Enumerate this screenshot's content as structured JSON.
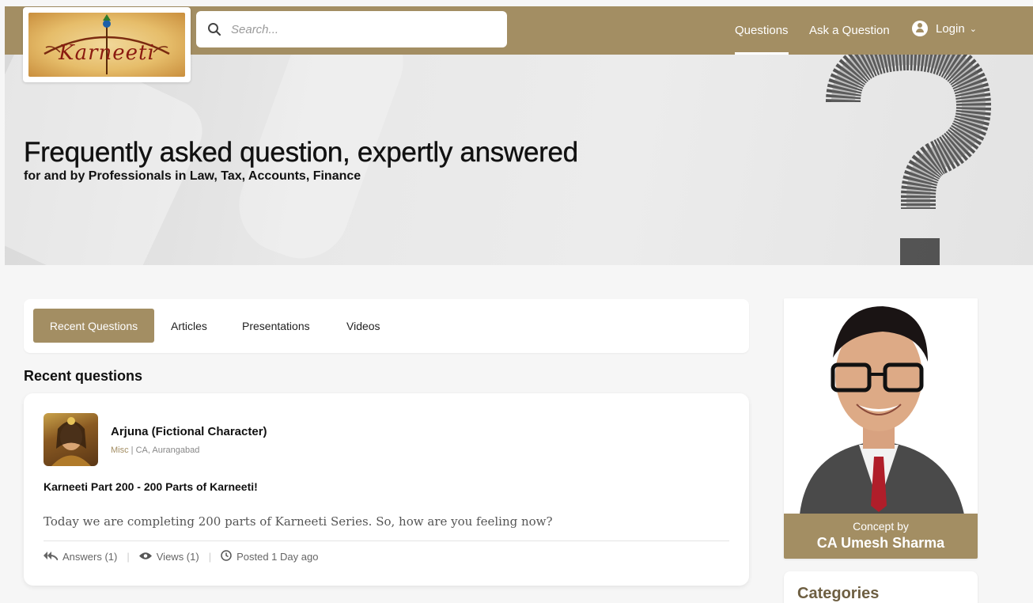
{
  "brand": {
    "logo_text": "Karneeti",
    "accent_color": "#a38e63"
  },
  "search": {
    "placeholder": "Search..."
  },
  "nav": {
    "questions": "Questions",
    "ask": "Ask a Question",
    "login": "Login"
  },
  "hero": {
    "title": "Frequently asked question, expertly answered",
    "subtitle": "for and by Professionals in Law, Tax, Accounts, Finance"
  },
  "tabs": [
    {
      "label": "Recent Questions",
      "active": true
    },
    {
      "label": "Articles",
      "active": false
    },
    {
      "label": "Presentations",
      "active": false
    },
    {
      "label": "Videos",
      "active": false
    }
  ],
  "section_title": "Recent questions",
  "question": {
    "author": "Arjuna (Fictional Character)",
    "category": "Misc",
    "author_detail": " | CA, Aurangabad",
    "title": "Karneeti Part 200 - 200 Parts of Karneeti!",
    "excerpt": "Today we are completing 200 parts of Karneeti Series. So, how are you feeling now?",
    "answers": "Answers (1)",
    "views": "Views (1)",
    "posted": "Posted 1 Day ago"
  },
  "sidebar": {
    "concept_label": "Concept by",
    "concept_name": "CA Umesh Sharma",
    "categories_title": "Categories"
  },
  "icons": {
    "search": "search-icon",
    "user": "user-icon",
    "chevron": "chevron-down-icon",
    "answers": "reply-all-icon",
    "views": "eye-icon",
    "posted": "clock-icon"
  }
}
